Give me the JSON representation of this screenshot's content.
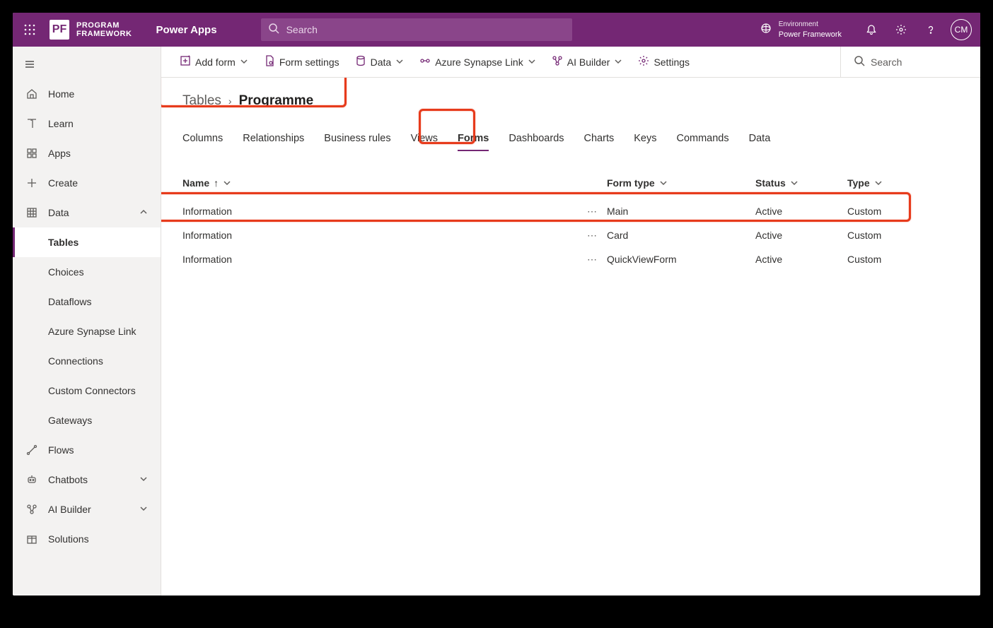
{
  "topbar": {
    "brand_line1": "PROGRAM",
    "brand_line2": "FRAMEWORK",
    "brand_logo": "PF",
    "app_title": "Power Apps",
    "search_placeholder": "Search",
    "env_label": "Environment",
    "env_name": "Power Framework",
    "avatar": "CM"
  },
  "sidebar": {
    "items": [
      {
        "label": "Home",
        "icon": "home"
      },
      {
        "label": "Learn",
        "icon": "book"
      },
      {
        "label": "Apps",
        "icon": "apps"
      },
      {
        "label": "Create",
        "icon": "plus"
      },
      {
        "label": "Data",
        "icon": "grid",
        "expanded": true,
        "children": [
          {
            "label": "Tables",
            "active": true
          },
          {
            "label": "Choices"
          },
          {
            "label": "Dataflows"
          },
          {
            "label": "Azure Synapse Link"
          },
          {
            "label": "Connections"
          },
          {
            "label": "Custom Connectors"
          },
          {
            "label": "Gateways"
          }
        ]
      },
      {
        "label": "Flows",
        "icon": "flow"
      },
      {
        "label": "Chatbots",
        "icon": "bot",
        "chevron": true
      },
      {
        "label": "AI Builder",
        "icon": "ai",
        "chevron": true
      },
      {
        "label": "Solutions",
        "icon": "package"
      }
    ]
  },
  "commandbar": {
    "items": [
      {
        "label": "Add form",
        "icon": "add-square",
        "chevron": true
      },
      {
        "label": "Form settings",
        "icon": "doc-gear"
      },
      {
        "label": "Data",
        "icon": "db",
        "chevron": true
      },
      {
        "label": "Azure Synapse Link",
        "icon": "synapse",
        "chevron": true
      },
      {
        "label": "AI Builder",
        "icon": "ai",
        "chevron": true
      },
      {
        "label": "Settings",
        "icon": "gear"
      }
    ],
    "search_placeholder": "Search"
  },
  "breadcrumb": {
    "root": "Tables",
    "current": "Programme"
  },
  "tabs": [
    "Columns",
    "Relationships",
    "Business rules",
    "Views",
    "Forms",
    "Dashboards",
    "Charts",
    "Keys",
    "Commands",
    "Data"
  ],
  "active_tab": "Forms",
  "grid": {
    "columns": [
      "Name",
      "Form type",
      "Status",
      "Type"
    ],
    "sort_col": "Name",
    "sort_dir": "asc",
    "rows": [
      {
        "name": "Information",
        "form_type": "Main",
        "status": "Active",
        "type": "Custom"
      },
      {
        "name": "Information",
        "form_type": "Card",
        "status": "Active",
        "type": "Custom"
      },
      {
        "name": "Information",
        "form_type": "QuickViewForm",
        "status": "Active",
        "type": "Custom"
      }
    ]
  }
}
